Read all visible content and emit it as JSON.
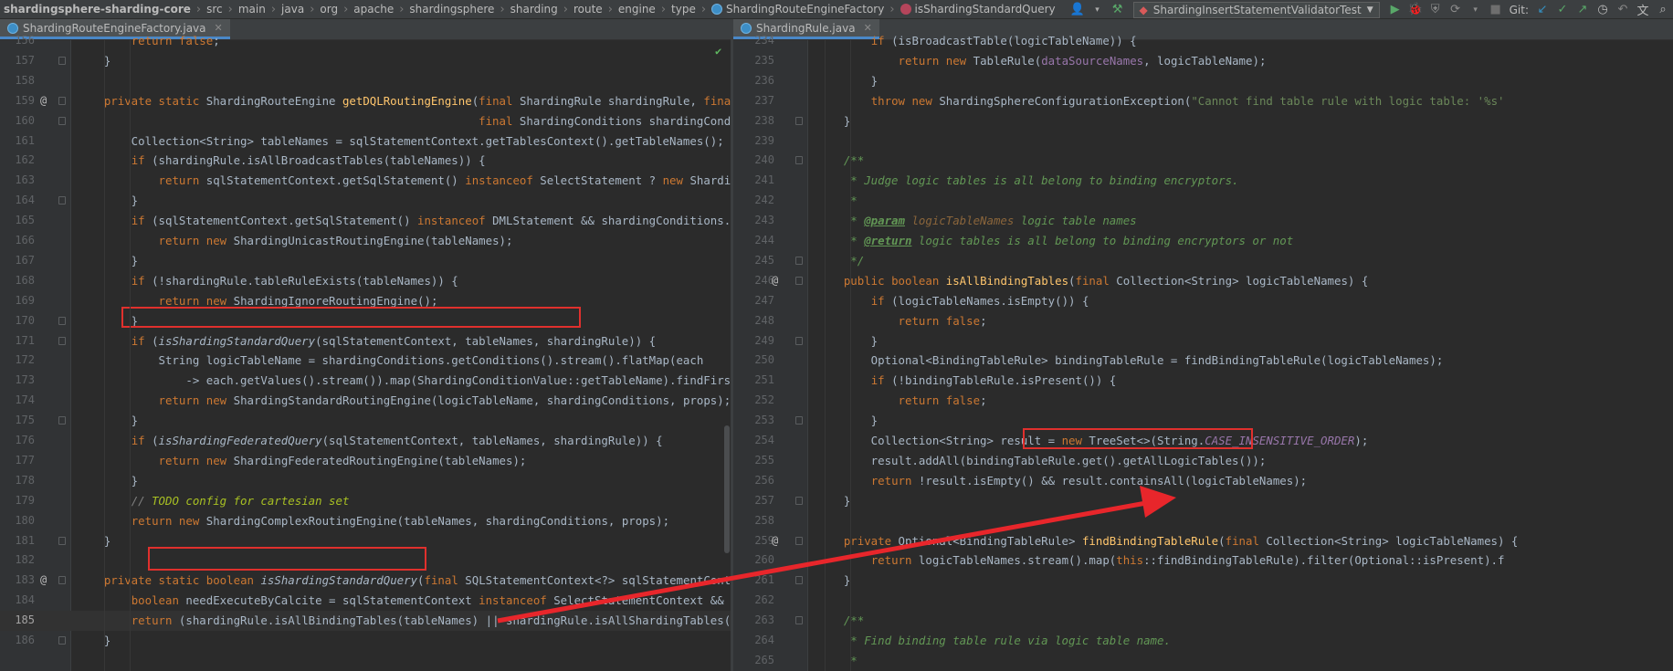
{
  "navbar": {
    "breadcrumb": [
      "shardingsphere-sharding-core",
      "src",
      "main",
      "java",
      "org",
      "apache",
      "shardingsphere",
      "sharding",
      "route",
      "engine",
      "type"
    ],
    "class_crumb": "ShardingRouteEngineFactory",
    "method_crumb": "isShardingStandardQuery",
    "run_config": "ShardingInsertStatementValidatorTest",
    "git_label": "Git:"
  },
  "left": {
    "tab_label": "ShardingRouteEngineFactory.java",
    "lines": [
      {
        "n": "156",
        "t": "        return false;"
      },
      {
        "n": "157",
        "t": "    }"
      },
      {
        "n": "158",
        "t": ""
      },
      {
        "n": "159",
        "t": "    private static ShardingRouteEngine getDQLRoutingEngine(final ShardingRule shardingRule, final SQLStatemen"
      },
      {
        "n": "160",
        "t": "                                                           final ShardingConditions shardingConditions, final"
      },
      {
        "n": "161",
        "t": "        Collection<String> tableNames = sqlStatementContext.getTablesContext().getTableNames();"
      },
      {
        "n": "162",
        "t": "        if (shardingRule.isAllBroadcastTables(tableNames)) {"
      },
      {
        "n": "163",
        "t": "            return sqlStatementContext.getSqlStatement() instanceof SelectStatement ? new ShardingUnicastRout"
      },
      {
        "n": "164",
        "t": "        }"
      },
      {
        "n": "165",
        "t": "        if (sqlStatementContext.getSqlStatement() instanceof DMLStatement && shardingConditions.isAlwaysFalse"
      },
      {
        "n": "166",
        "t": "            return new ShardingUnicastRoutingEngine(tableNames);"
      },
      {
        "n": "167",
        "t": "        }"
      },
      {
        "n": "168",
        "t": "        if (!shardingRule.tableRuleExists(tableNames)) {"
      },
      {
        "n": "169",
        "t": "            return new ShardingIgnoreRoutingEngine();"
      },
      {
        "n": "170",
        "t": "        }"
      },
      {
        "n": "171",
        "t": "        if (isShardingStandardQuery(sqlStatementContext, tableNames, shardingRule)) {"
      },
      {
        "n": "172",
        "t": "            String logicTableName = shardingConditions.getConditions().stream().flatMap(each"
      },
      {
        "n": "173",
        "t": "                -> each.getValues().stream()).map(ShardingConditionValue::getTableName).findFirst().orElseGet"
      },
      {
        "n": "174",
        "t": "            return new ShardingStandardRoutingEngine(logicTableName, shardingConditions, props);"
      },
      {
        "n": "175",
        "t": "        }"
      },
      {
        "n": "176",
        "t": "        if (isShardingFederatedQuery(sqlStatementContext, tableNames, shardingRule)) {"
      },
      {
        "n": "177",
        "t": "            return new ShardingFederatedRoutingEngine(tableNames);"
      },
      {
        "n": "178",
        "t": "        }"
      },
      {
        "n": "179",
        "t": "        // TODO config for cartesian set"
      },
      {
        "n": "180",
        "t": "        return new ShardingComplexRoutingEngine(tableNames, shardingConditions, props);"
      },
      {
        "n": "181",
        "t": "    }"
      },
      {
        "n": "182",
        "t": ""
      },
      {
        "n": "183",
        "t": "    private static boolean isShardingStandardQuery(final SQLStatementContext<?> sqlStatementContext, final Co"
      },
      {
        "n": "184",
        "t": "        boolean needExecuteByCalcite = sqlStatementContext instanceof SelectStatementContext && isNeedExecute"
      },
      {
        "n": "185",
        "t": "        return (shardingRule.isAllBindingTables(tableNames) || shardingRule.isAllShardingTables(tableNames) &"
      },
      {
        "n": "186",
        "t": "    }"
      }
    ]
  },
  "right": {
    "tab_label": "ShardingRule.java",
    "lines": [
      {
        "n": "234",
        "t": "        if (isBroadcastTable(logicTableName)) {"
      },
      {
        "n": "235",
        "t": "            return new TableRule(dataSourceNames, logicTableName);"
      },
      {
        "n": "236",
        "t": "        }"
      },
      {
        "n": "237",
        "t": "        throw new ShardingSphereConfigurationException(\"Cannot find table rule with logic table: '%s'"
      },
      {
        "n": "238",
        "t": "    }"
      },
      {
        "n": "239",
        "t": ""
      },
      {
        "n": "240",
        "t": "    /**"
      },
      {
        "n": "241",
        "t": "     * Judge logic tables is all belong to binding encryptors."
      },
      {
        "n": "242",
        "t": "     *"
      },
      {
        "n": "243",
        "t": "     * @param logicTableNames logic table names"
      },
      {
        "n": "244",
        "t": "     * @return logic tables is all belong to binding encryptors or not"
      },
      {
        "n": "245",
        "t": "     */"
      },
      {
        "n": "246",
        "t": "    public boolean isAllBindingTables(final Collection<String> logicTableNames) {"
      },
      {
        "n": "247",
        "t": "        if (logicTableNames.isEmpty()) {"
      },
      {
        "n": "248",
        "t": "            return false;"
      },
      {
        "n": "249",
        "t": "        }"
      },
      {
        "n": "250",
        "t": "        Optional<BindingTableRule> bindingTableRule = findBindingTableRule(logicTableNames);"
      },
      {
        "n": "251",
        "t": "        if (!bindingTableRule.isPresent()) {"
      },
      {
        "n": "252",
        "t": "            return false;"
      },
      {
        "n": "253",
        "t": "        }"
      },
      {
        "n": "254",
        "t": "        Collection<String> result = new TreeSet<>(String.CASE_INSENSITIVE_ORDER);"
      },
      {
        "n": "255",
        "t": "        result.addAll(bindingTableRule.get().getAllLogicTables());"
      },
      {
        "n": "256",
        "t": "        return !result.isEmpty() && result.containsAll(logicTableNames);"
      },
      {
        "n": "257",
        "t": "    }"
      },
      {
        "n": "258",
        "t": ""
      },
      {
        "n": "259",
        "t": "    private Optional<BindingTableRule> findBindingTableRule(final Collection<String> logicTableNames) {"
      },
      {
        "n": "260",
        "t": "        return logicTableNames.stream().map(this::findBindingTableRule).filter(Optional::isPresent).f"
      },
      {
        "n": "261",
        "t": "    }"
      },
      {
        "n": "262",
        "t": ""
      },
      {
        "n": "263",
        "t": "    /**"
      },
      {
        "n": "264",
        "t": "     * Find binding table rule via logic table name."
      },
      {
        "n": "265",
        "t": "     *"
      }
    ]
  },
  "colors": {
    "background": "#2b2b2b",
    "keyword": "#cc7832",
    "method": "#ffc66d",
    "string": "#6a8759",
    "annotation_box": "#e0302d",
    "arrow": "#e8262b"
  }
}
